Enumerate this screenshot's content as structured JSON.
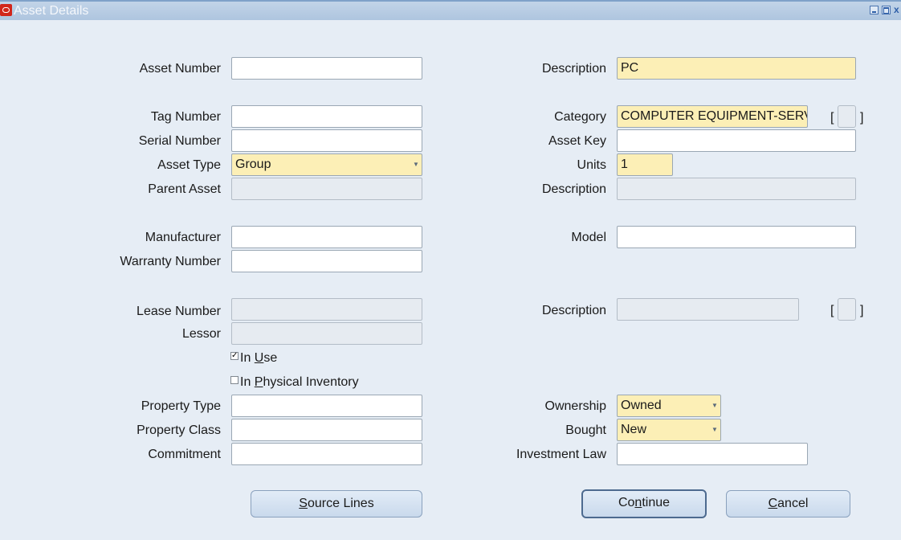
{
  "window": {
    "title": "Asset Details",
    "icon": "oracle-icon"
  },
  "left_fields": {
    "asset_number": {
      "label": "Asset Number",
      "value": ""
    },
    "tag_number": {
      "label": "Tag Number",
      "value": ""
    },
    "serial_number": {
      "label": "Serial Number",
      "value": ""
    },
    "asset_type": {
      "label": "Asset Type",
      "value": "Group"
    },
    "parent_asset": {
      "label": "Parent Asset",
      "value": ""
    },
    "manufacturer": {
      "label": "Manufacturer",
      "value": ""
    },
    "warranty_number": {
      "label": "Warranty Number",
      "value": ""
    },
    "lease_number": {
      "label": "Lease Number",
      "value": ""
    },
    "lessor": {
      "label": "Lessor",
      "value": ""
    },
    "property_type": {
      "label": "Property Type",
      "value": ""
    },
    "property_class": {
      "label": "Property Class",
      "value": ""
    },
    "commitment": {
      "label": "Commitment",
      "value": ""
    }
  },
  "right_fields": {
    "description": {
      "label": "Description",
      "value": "PC"
    },
    "category": {
      "label": "Category",
      "value": "COMPUTER EQUIPMENT-SERVER"
    },
    "asset_key": {
      "label": "Asset Key",
      "value": ""
    },
    "units": {
      "label": "Units",
      "value": "1"
    },
    "parent_description": {
      "label": "Description",
      "value": ""
    },
    "model": {
      "label": "Model",
      "value": ""
    },
    "lease_description": {
      "label": "Description",
      "value": ""
    },
    "ownership": {
      "label": "Ownership",
      "value": "Owned"
    },
    "bought": {
      "label": "Bought",
      "value": "New"
    },
    "investment_law": {
      "label": "Investment Law",
      "value": ""
    }
  },
  "checkboxes": {
    "in_use": {
      "pre": "In ",
      "mnemonic": "U",
      "post": "se",
      "checked": true
    },
    "in_physical_inventory": {
      "pre": "In ",
      "mnemonic": "P",
      "post": "hysical Inventory",
      "checked": false
    }
  },
  "brackets": {
    "open": "[",
    "close": "]"
  },
  "buttons": {
    "source_lines": {
      "mnemonic": "S",
      "post": "ource Lines"
    },
    "continue": {
      "pre": "Co",
      "mnemonic": "n",
      "post": "tinue"
    },
    "cancel": {
      "mnemonic": "C",
      "post": "ancel"
    }
  },
  "colors": {
    "background": "#e6edf5",
    "required_field": "#fcefb6",
    "readonly_field": "#e6ebf1",
    "titlebar": "#aec5df"
  }
}
